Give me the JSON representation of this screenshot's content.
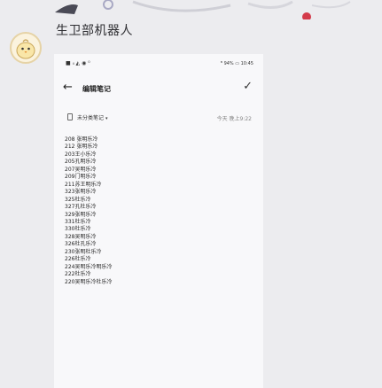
{
  "chat": {
    "bot_name": "生卫部机器人"
  },
  "phone": {
    "status_left": "■ ᵢₗ ◭ ◉ ⁰",
    "status_right": "ᴮ 94% ▭ 10:45",
    "title": "编辑笔记",
    "folder": "未分类笔记",
    "meta": "今天 晚上9:22",
    "lines": [
      "208 张明乐冷",
      "212 张明乐冷",
      "203王小乐冷",
      "205孔明乐冷",
      "207吴明乐冷",
      "209门明乐冷",
      "211苏王明乐冷",
      "323张明乐冷",
      "325杜乐冷",
      "327孔杜乐冷",
      "329张明乐冷",
      "331杜乐冷",
      "330杜乐冷",
      "328吴明乐冷",
      "326杜孔乐冷",
      "230张明杜乐冷",
      "226杜乐冷",
      "224吴明乐冷明乐冷",
      "222杜乐冷",
      "220吴明乐冷杜乐冷"
    ]
  },
  "colors": {
    "background": "#ececef",
    "phone_background": "#f8f8fa",
    "accent_decor": "#d33a4a"
  }
}
